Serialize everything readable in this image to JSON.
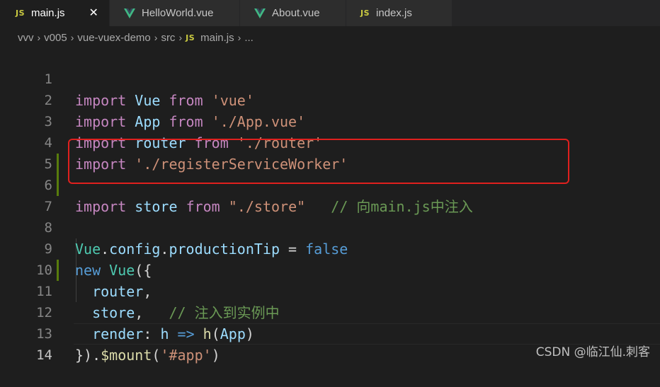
{
  "tabs": [
    {
      "label": "main.js",
      "icon": "js-icon",
      "active": true
    },
    {
      "label": "HelloWorld.vue",
      "icon": "vue-icon"
    },
    {
      "label": "About.vue",
      "icon": "vue-icon"
    },
    {
      "label": "index.js",
      "icon": "js-icon"
    }
  ],
  "js_icon_text": "JS",
  "close_glyph": "✕",
  "breadcrumb": [
    "vvv",
    "v005",
    "vue-vuex-demo",
    "src",
    "main.js",
    "..."
  ],
  "code": {
    "line_numbers": [
      "1",
      "2",
      "3",
      "4",
      "5",
      "6",
      "7",
      "8",
      "9",
      "10",
      "11",
      "12",
      "13",
      "14"
    ],
    "l1": {
      "t0": "import",
      "t1": " ",
      "t2": "Vue",
      "t3": " ",
      "t4": "from",
      "t5": " ",
      "t6": "'vue'"
    },
    "l2": {
      "t0": "import",
      "t1": " ",
      "t2": "App",
      "t3": " ",
      "t4": "from",
      "t5": " ",
      "t6": "'./App.vue'"
    },
    "l3": {
      "t0": "import",
      "t1": " ",
      "t2": "router",
      "t3": " ",
      "t4": "from",
      "t5": " ",
      "t6": "'./router'"
    },
    "l4": {
      "t0": "import",
      "t1": " ",
      "t2": "'./registerServiceWorker'"
    },
    "l6": {
      "t0": "import",
      "t1": " ",
      "t2": "store",
      "t3": " ",
      "t4": "from",
      "t5": " ",
      "t6": "\"./store\"",
      "t7": "   ",
      "t8": "// 向main.js中注入"
    },
    "l8": {
      "t0": "Vue",
      "t1": ".",
      "t2": "config",
      "t3": ".",
      "t4": "productionTip",
      "t5": " = ",
      "t6": "false"
    },
    "l9": {
      "t0": "new",
      "t1": " ",
      "t2": "Vue",
      "t3": "({"
    },
    "l10": {
      "t0": "  ",
      "t1": "router",
      "t2": ","
    },
    "l11": {
      "t0": "  ",
      "t1": "store",
      "t2": ",   ",
      "t3": "// 注入到实例中"
    },
    "l12": {
      "t0": "  ",
      "t1": "render",
      "t2": ": ",
      "t3": "h",
      "t4": " ",
      "t5": "=>",
      "t6": " ",
      "t7": "h",
      "t8": "(",
      "t9": "App",
      "t10": ")"
    },
    "l13": {
      "t0": "})",
      "t1": ".",
      "t2": "$mount",
      "t3": "(",
      "t4": "'#app'",
      "t5": ")"
    }
  },
  "watermark": "CSDN @临江仙.刺客",
  "colors": {
    "background": "#1e1e1e",
    "highlight_box": "#e0201e",
    "keyword": "#c586c0",
    "comment": "#6a9955",
    "string": "#ce9178"
  }
}
